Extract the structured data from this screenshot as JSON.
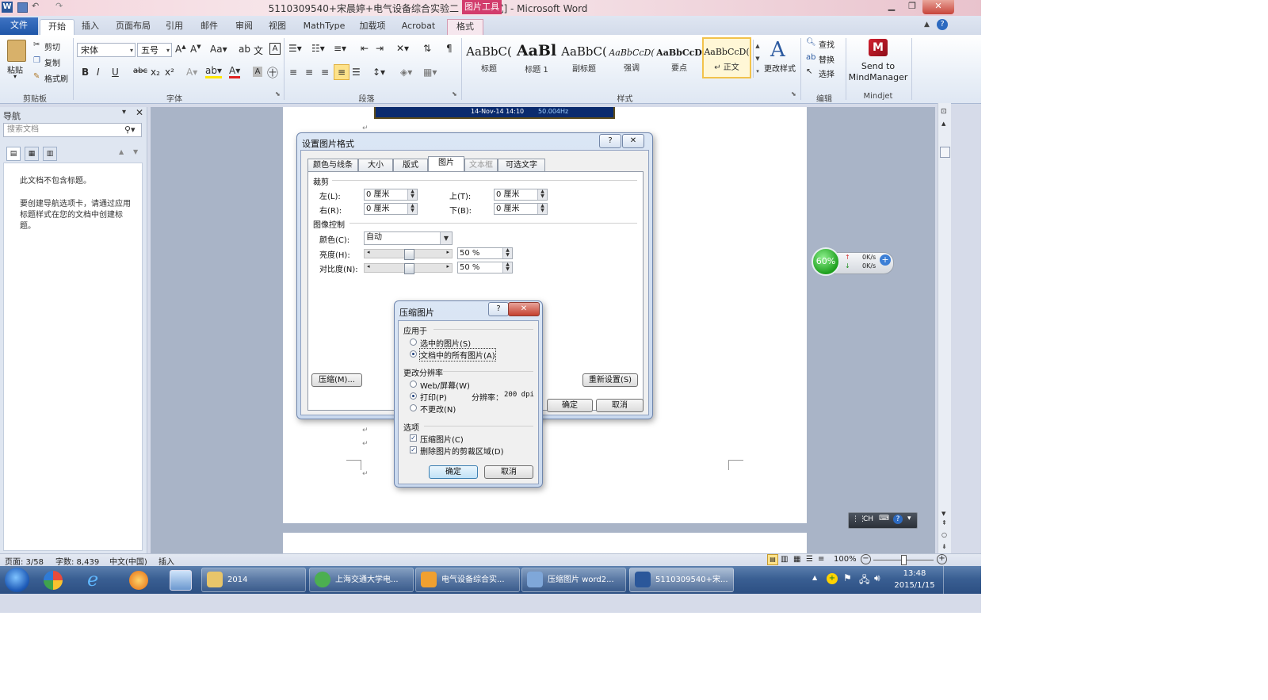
{
  "window": {
    "title": "5110309540+宋晨婷+电气设备综合实验二 [兼容模式] - Microsoft Word",
    "context_tab_group": "图片工具",
    "app_icon": "W"
  },
  "tabs": [
    "文件",
    "开始",
    "插入",
    "页面布局",
    "引用",
    "邮件",
    "审阅",
    "视图",
    "MathType",
    "加载项",
    "Acrobat",
    "格式"
  ],
  "ribbon": {
    "clipboard": {
      "paste": "粘贴",
      "cut": "剪切",
      "copy": "复制",
      "format_painter": "格式刷",
      "label": "剪贴板"
    },
    "font": {
      "name": "宋体",
      "size": "五号",
      "label": "字体"
    },
    "paragraph": {
      "label": "段落"
    },
    "styles": {
      "items": [
        {
          "sample": "AaBbC(",
          "name": "标题"
        },
        {
          "sample": "AaBl",
          "name": "标题 1"
        },
        {
          "sample": "AaBbC(",
          "name": "副标题"
        },
        {
          "sample": "AaBbCcD(",
          "name": "强调"
        },
        {
          "sample": "AaBbCcD",
          "name": "要点"
        },
        {
          "sample": "AaBbCcD(",
          "name": "↵ 正文"
        }
      ],
      "change_styles": "更改样式",
      "label": "样式"
    },
    "editing": {
      "find": "查找",
      "replace": "替换",
      "select": "选择",
      "label": "编辑"
    },
    "mindjet": {
      "send_to": "Send to",
      "target": "MindManager",
      "label": "Mindjet"
    }
  },
  "nav_pane": {
    "title": "导航",
    "search_placeholder": "搜索文档",
    "no_headings": "此文档不包含标题。",
    "hint": "要创建导航选项卡，请通过应用标题样式在您的文档中创建标题。"
  },
  "doc": {
    "image_caption": "14-Nov-14 14:10",
    "image_freq": "50.004Hz"
  },
  "format_dialog": {
    "title": "设置图片格式",
    "tabs": [
      "颜色与线条",
      "大小",
      "版式",
      "图片",
      "文本框",
      "可选文字"
    ],
    "crop_section": "裁剪",
    "left_label": "左(L):",
    "left_value": "0 厘米",
    "top_label": "上(T):",
    "top_value": "0 厘米",
    "right_label": "右(R):",
    "right_value": "0 厘米",
    "bottom_label": "下(B):",
    "bottom_value": "0 厘米",
    "image_control": "图像控制",
    "color_label": "颜色(C):",
    "color_value": "自动",
    "brightness_label": "亮度(H):",
    "brightness_value": "50 %",
    "brightness_level": 0.5,
    "contrast_label": "对比度(N):",
    "contrast_value": "50 %",
    "contrast_level": 0.5,
    "compress_btn": "压缩(M)...",
    "reset_btn": "重新设置(S)",
    "ok": "确定",
    "cancel": "取消"
  },
  "compress_dialog": {
    "title": "压缩图片",
    "apply_to": "应用于",
    "selected": "选中的图片(S)",
    "all": "文档中的所有图片(A)",
    "resolution": "更改分辨率",
    "web": "Web/屏幕(W)",
    "print": "打印(P)",
    "no_change": "不更改(N)",
    "resolution_label": "分辨率：",
    "resolution_value": "200 dpi",
    "options": "选项",
    "compress_opt": "压缩图片(C)",
    "delete_crop": "删除图片的剪裁区域(D)",
    "ok": "确定",
    "cancel": "取消"
  },
  "widget": {
    "percent": "60%",
    "up": "0K/s",
    "down": "0K/s"
  },
  "ime": {
    "lang": "CH"
  },
  "status": {
    "page": "页面: 3/58",
    "words": "字数: 8,439",
    "lang": "中文(中国)",
    "mode": "插入",
    "zoom": "100%",
    "zoom_level": 0.5
  },
  "taskbar": {
    "items": [
      {
        "label": "2014",
        "color": "#e8c56a"
      },
      {
        "label": "上海交通大学电...",
        "color": "#4caf50"
      },
      {
        "label": "电气设备综合实...",
        "color": "#f0a030"
      },
      {
        "label": "压缩图片 word2...",
        "color": "#7fa7d9"
      },
      {
        "label": "5110309540+宋...",
        "color": "#2b579a"
      }
    ],
    "time": "13:48",
    "date": "2015/1/15"
  }
}
